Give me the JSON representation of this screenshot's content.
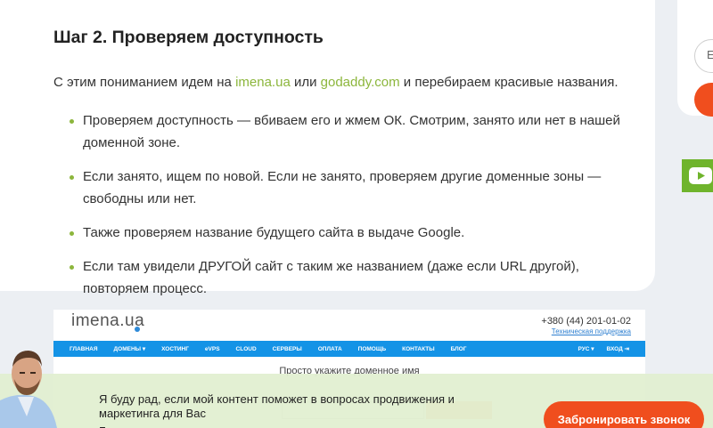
{
  "article": {
    "heading": "Шаг 2. Проверяем доступность",
    "intro_prefix": "С этим пониманием идем на ",
    "link1": "imena.ua",
    "intro_or": " или ",
    "link2": "godaddy.com",
    "intro_suffix": " и перебираем красивые названия.",
    "bullets": [
      {
        "line1": "Проверяем доступность — вбиваем его и жмем ОК. Смотрим, занято или нет в нашей",
        "line2": "доменной зоне."
      },
      {
        "line1": "Если занято, ищем по новой. Если не занято, проверяем другие доменные зоны —",
        "line2": "свободны или нет."
      },
      {
        "line1": "Также проверяем название будущего сайта в выдаче Google.",
        "line2": ""
      },
      {
        "line1": "Если там увидели ДРУГОЙ сайт с таким же названием (даже если URL другой),",
        "line2": "повторяем процесс."
      }
    ]
  },
  "screenshot": {
    "logo": "imena.ua",
    "phone": "+380 (44) 201-01-02",
    "support": "Техническая поддержка",
    "nav": [
      "ГЛАВНАЯ",
      "ДОМЕНЫ ▾",
      "ХОСТИНГ",
      "eVPS",
      "CLOUD",
      "СЕРВЕРЫ",
      "ОПЛАТА",
      "ПОМОЩЬ",
      "КОНТАКТЫ",
      "БЛОГ"
    ],
    "nav_right": [
      "РУС ▾",
      "ВХОД ⇥"
    ],
    "prompt": "Просто укажите доменное имя"
  },
  "sidebar": {
    "input_partial": "Е"
  },
  "callback": {
    "message": "Я буду рад, если мой контент поможет в вопросах продвижения и маркетинга для Вас",
    "message_cut": "Б",
    "button": "Забронировать звонок"
  },
  "colors": {
    "accent_green": "#8cb63c",
    "accent_orange": "#f04e1e",
    "nav_blue": "#1493e6"
  },
  "icons": [
    "youtube-icon",
    "avatar-photo"
  ]
}
